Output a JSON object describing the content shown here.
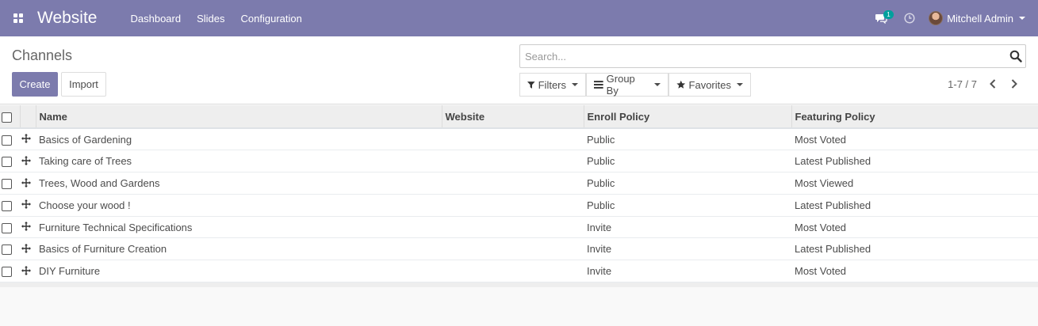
{
  "navbar": {
    "brand": "Website",
    "menu": [
      "Dashboard",
      "Slides",
      "Configuration"
    ],
    "messages_count": "1",
    "user_name": "Mitchell Admin"
  },
  "control_panel": {
    "breadcrumb": "Channels",
    "create_label": "Create",
    "import_label": "Import",
    "search_placeholder": "Search...",
    "filters_label": "Filters",
    "group_by_label": "Group By",
    "favorites_label": "Favorites",
    "pager": "1-7 / 7"
  },
  "table": {
    "columns": [
      "Name",
      "Website",
      "Enroll Policy",
      "Featuring Policy"
    ],
    "rows": [
      {
        "name": "Basics of Gardening",
        "website": "",
        "enroll": "Public",
        "featuring": "Most Voted"
      },
      {
        "name": "Taking care of Trees",
        "website": "",
        "enroll": "Public",
        "featuring": "Latest Published"
      },
      {
        "name": "Trees, Wood and Gardens",
        "website": "",
        "enroll": "Public",
        "featuring": "Most Viewed"
      },
      {
        "name": "Choose your wood !",
        "website": "",
        "enroll": "Public",
        "featuring": "Latest Published"
      },
      {
        "name": "Furniture Technical Specifications",
        "website": "",
        "enroll": "Invite",
        "featuring": "Most Voted"
      },
      {
        "name": "Basics of Furniture Creation",
        "website": "",
        "enroll": "Invite",
        "featuring": "Latest Published"
      },
      {
        "name": "DIY Furniture",
        "website": "",
        "enroll": "Invite",
        "featuring": "Most Voted"
      }
    ]
  },
  "colors": {
    "brand": "#7c7bad",
    "badge": "#00a09d"
  }
}
